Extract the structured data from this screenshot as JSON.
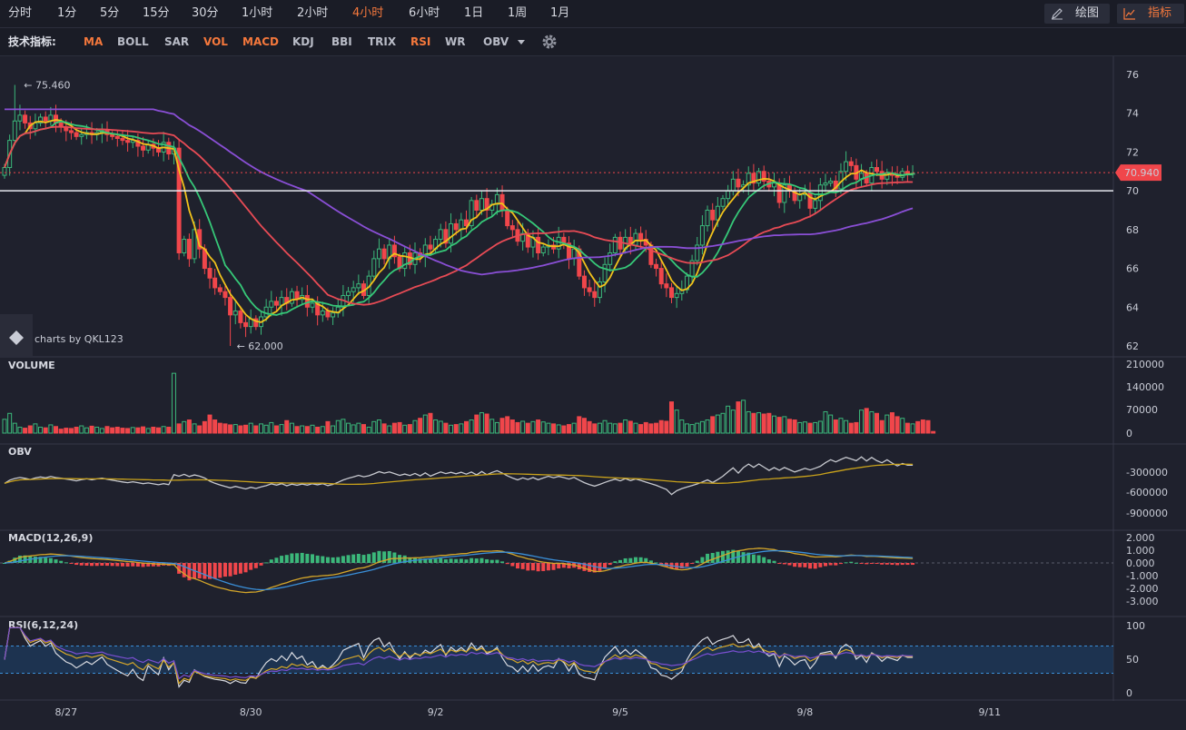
{
  "toolbar": {
    "timeframes": [
      {
        "label": "分时",
        "active": false
      },
      {
        "label": "1分",
        "active": false
      },
      {
        "label": "5分",
        "active": false
      },
      {
        "label": "15分",
        "active": false
      },
      {
        "label": "30分",
        "active": false
      },
      {
        "label": "1小时",
        "active": false
      },
      {
        "label": "2小时",
        "active": false
      },
      {
        "label": "4小时",
        "active": true
      },
      {
        "label": "6小时",
        "active": false
      },
      {
        "label": "1日",
        "active": false
      },
      {
        "label": "1周",
        "active": false
      },
      {
        "label": "1月",
        "active": false
      }
    ],
    "draw_label": "绘图",
    "draw_icon": "pencil-icon",
    "indicator_label": "指标",
    "indicator_icon": "line-chart-icon"
  },
  "indicator_bar": {
    "title": "技术指标:",
    "items": [
      {
        "label": "MA",
        "active": true
      },
      {
        "label": "BOLL",
        "active": false
      },
      {
        "label": "SAR",
        "active": false
      },
      {
        "label": "VOL",
        "active": true
      },
      {
        "label": "MACD",
        "active": true
      },
      {
        "label": "KDJ",
        "active": false
      },
      {
        "label": "BBI",
        "active": false
      },
      {
        "label": "TRIX",
        "active": false
      },
      {
        "label": "RSI",
        "active": true
      },
      {
        "label": "WR",
        "active": false
      }
    ],
    "dropdown_label": "OBV",
    "dropdown_icon": "caret-down-icon",
    "settings_icon": "gear-icon"
  },
  "colors": {
    "up": "#3bb77a",
    "down": "#f0464b",
    "accent": "#f5783c",
    "ma5": "#f2c21b",
    "ma10": "#36c878",
    "ma30": "#e84b55",
    "ma60": "#8a4fd6",
    "obv": "#c7c9cf",
    "obv_ma": "#c9a21b",
    "dif": "#d4a62a",
    "dea": "#3a8fd8",
    "rsi6": "#d8dae0",
    "rsi12": "#d4a62a",
    "rsi24": "#7a4fd0"
  },
  "watermark": {
    "text": "charts by QKL123",
    "icon": "qkl-logo-icon"
  },
  "chart_data": [
    {
      "type": "candlestick",
      "panel": "main",
      "x_ticks": [
        "8/27",
        "8/30",
        "9/2",
        "9/5",
        "9/8",
        "9/11"
      ],
      "x_tick_index": [
        12,
        48,
        84,
        120,
        156,
        192
      ],
      "ylim": [
        62,
        76
      ],
      "y_ticks": [
        62,
        64,
        66,
        68,
        70,
        72,
        74,
        76
      ],
      "last_price": "70.940",
      "horizontal_line": 70.0,
      "high_marker": {
        "label": "← 75.460",
        "index": 2,
        "value": 75.46
      },
      "low_marker": {
        "label": "← 62.000",
        "index": 44,
        "value": 62.0
      },
      "closes": [
        71.2,
        72.6,
        73.6,
        73.9,
        73.5,
        73.2,
        73.5,
        73.8,
        73.6,
        73.9,
        73.5,
        73.3,
        73.1,
        73.0,
        72.8,
        72.9,
        73.0,
        72.9,
        73.0,
        73.1,
        72.9,
        72.8,
        72.7,
        72.6,
        72.5,
        72.6,
        72.3,
        72.1,
        72.4,
        72.2,
        72.0,
        72.5,
        71.9,
        72.2,
        66.8,
        67.5,
        66.5,
        68.0,
        67.0,
        66.0,
        65.5,
        65.0,
        64.8,
        64.5,
        63.6,
        63.8,
        63.2,
        63.0,
        63.4,
        63.0,
        63.5,
        64.0,
        64.3,
        64.1,
        64.5,
        64.2,
        64.8,
        64.4,
        64.6,
        64.0,
        64.2,
        63.6,
        63.8,
        63.5,
        63.7,
        64.0,
        64.6,
        64.8,
        65.0,
        65.2,
        64.6,
        65.6,
        66.5,
        67.0,
        66.5,
        67.2,
        66.6,
        66.0,
        66.8,
        66.2,
        66.8,
        66.6,
        67.2,
        67.0,
        67.5,
        68.0,
        67.3,
        68.3,
        68.0,
        68.5,
        68.2,
        69.5,
        69.0,
        69.6,
        69.0,
        69.3,
        69.8,
        69.0,
        68.2,
        68.0,
        67.4,
        67.8,
        67.1,
        67.6,
        66.8,
        67.1,
        67.2,
        67.0,
        67.6,
        67.3,
        66.5,
        67.0,
        65.6,
        65.0,
        64.8,
        64.5,
        65.3,
        66.2,
        66.8,
        67.6,
        67.0,
        67.6,
        67.2,
        67.8,
        67.5,
        67.2,
        66.2,
        66.0,
        65.2,
        65.0,
        64.5,
        64.7,
        64.9,
        65.6,
        66.4,
        67.2,
        68.2,
        69.0,
        68.5,
        69.2,
        69.6,
        70.0,
        70.6,
        70.2,
        70.3,
        70.9,
        70.4,
        71.0,
        70.5,
        70.2,
        70.4,
        69.4,
        70.3,
        70.0,
        69.5,
        69.8,
        69.9,
        69.1,
        69.5,
        70.3,
        70.4,
        70.5,
        70.1,
        71.0,
        71.5,
        71.3,
        70.6,
        70.9,
        70.4,
        71.2,
        71.0,
        70.6,
        70.9,
        70.8,
        70.7,
        71.0,
        70.9,
        70.9
      ],
      "series": [
        {
          "name": "MA5"
        },
        {
          "name": "MA10"
        },
        {
          "name": "MA30"
        },
        {
          "name": "MA60"
        }
      ]
    },
    {
      "type": "bar",
      "panel": "volume",
      "title": "VOLUME",
      "ylim": [
        0,
        210000
      ],
      "y_ticks": [
        "210000",
        "140000",
        "70000",
        "0"
      ],
      "values": [
        42000,
        60000,
        30000,
        18000,
        15000,
        22000,
        28000,
        18000,
        16000,
        25000,
        20000,
        12000,
        15000,
        14000,
        18000,
        22000,
        16000,
        21000,
        18000,
        14000,
        20000,
        16000,
        18000,
        15000,
        14000,
        17000,
        16000,
        19000,
        14000,
        18000,
        16000,
        20000,
        18000,
        182000,
        28000,
        35000,
        40000,
        28000,
        22000,
        35000,
        55000,
        40000,
        30000,
        28000,
        25000,
        26000,
        22000,
        24000,
        30000,
        22000,
        28000,
        24000,
        32000,
        22000,
        26000,
        38000,
        30000,
        20000,
        22000,
        20000,
        24000,
        18000,
        20000,
        35000,
        22000,
        38000,
        42000,
        30000,
        25000,
        30000,
        26000,
        18000,
        35000,
        40000,
        28000,
        22000,
        30000,
        32000,
        24000,
        26000,
        38000,
        45000,
        55000,
        60000,
        40000,
        36000,
        30000,
        24000,
        26000,
        28000,
        35000,
        40000,
        55000,
        62000,
        58000,
        42000,
        32000,
        45000,
        50000,
        40000,
        32000,
        36000,
        30000,
        35000,
        40000,
        34000,
        30000,
        28000,
        25000,
        22000,
        26000,
        30000,
        50000,
        45000,
        35000,
        28000,
        30000,
        38000,
        30000,
        28000,
        30000,
        40000,
        36000,
        30000,
        26000,
        32000,
        28000,
        30000,
        38000,
        36000,
        95000,
        70000,
        40000,
        28000,
        26000,
        30000,
        35000,
        40000,
        50000,
        55000,
        60000,
        82000,
        70000,
        95000,
        100000,
        65000,
        60000,
        62000,
        58000,
        60000,
        52000,
        48000,
        50000,
        42000,
        40000,
        32000,
        34000,
        30000,
        32000,
        36000,
        65000,
        55000,
        40000,
        45000,
        38000,
        30000,
        32000,
        70000,
        75000,
        65000,
        60000,
        38000,
        55000,
        62000,
        50000,
        45000,
        30000,
        28000,
        35000,
        40000,
        38000,
        5000
      ]
    },
    {
      "type": "line",
      "panel": "obv",
      "title": "OBV",
      "ylim": [
        -1000000,
        -200000
      ],
      "y_ticks": [
        "-300000",
        "-600000",
        "-900000"
      ],
      "series": [
        {
          "name": "OBV"
        },
        {
          "name": "OBV_MA"
        }
      ]
    },
    {
      "type": "bar",
      "panel": "macd",
      "title": "MACD(12,26,9)",
      "ylim": [
        -3.5,
        2.5
      ],
      "y_ticks": [
        "2.000",
        "1.000",
        "0.000",
        "-1.000",
        "-2.000",
        "-3.000"
      ],
      "series": [
        {
          "name": "DIF"
        },
        {
          "name": "DEA"
        },
        {
          "name": "MACD"
        }
      ]
    },
    {
      "type": "line",
      "panel": "rsi",
      "title": "RSI(6,12,24)",
      "ylim": [
        0,
        100
      ],
      "y_ticks": [
        "100",
        "50",
        "0"
      ],
      "band": [
        30,
        70
      ],
      "series": [
        {
          "name": "RSI6"
        },
        {
          "name": "RSI12"
        },
        {
          "name": "RSI24"
        }
      ]
    }
  ]
}
